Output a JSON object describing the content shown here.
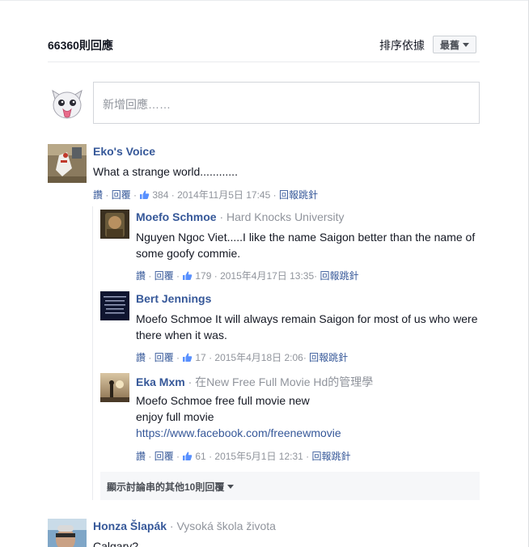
{
  "header": {
    "comment_count": "66360則回應",
    "sort_label": "排序依據",
    "sort_value": "最舊"
  },
  "composer": {
    "placeholder": "新增回應……"
  },
  "comments": [
    {
      "name": "Eko's Voice",
      "org": "",
      "text": "What a strange world............",
      "like_label": "讚",
      "reply_label": "回覆",
      "likes": "384",
      "time": "2014年11月5日 17:45",
      "report_label": "回報跳針"
    },
    {
      "name": "Moefo Schmoe",
      "org": "Hard Knocks University",
      "text": "Nguyen Ngoc Viet.....I like the name Saigon better than the name of some goofy commie.",
      "like_label": "讚",
      "reply_label": "回覆",
      "likes": "179",
      "time": "2015年4月17日 13:35",
      "report_label": "回報跳針"
    },
    {
      "name": "Bert Jennings",
      "org": "",
      "text": "Moefo Schmoe It will always remain Saigon for most of us who were there when it was.",
      "like_label": "讚",
      "reply_label": "回覆",
      "likes": "17",
      "time": "2015年4月18日 2:06",
      "report_label": "回報跳針"
    },
    {
      "name": "Eka Mxm",
      "org": "在New Free Full Movie Hd的管理學",
      "text_line1": "Moefo Schmoe free full movie new",
      "text_line2": "enjoy full movie",
      "link": "https://www.facebook.com/freenewmovie",
      "like_label": "讚",
      "reply_label": "回覆",
      "likes": "61",
      "time": "2015年5月1日 12:31",
      "report_label": "回報跳針"
    },
    {
      "name": "Honza Šlapák",
      "org": "Vysoká škola života",
      "text": "Calgary?"
    }
  ],
  "more_replies": "顯示討論串的其他10則回覆",
  "colors": {
    "link": "#365899",
    "meta": "#90949c",
    "text": "#141823",
    "border": "#e9ebee"
  }
}
